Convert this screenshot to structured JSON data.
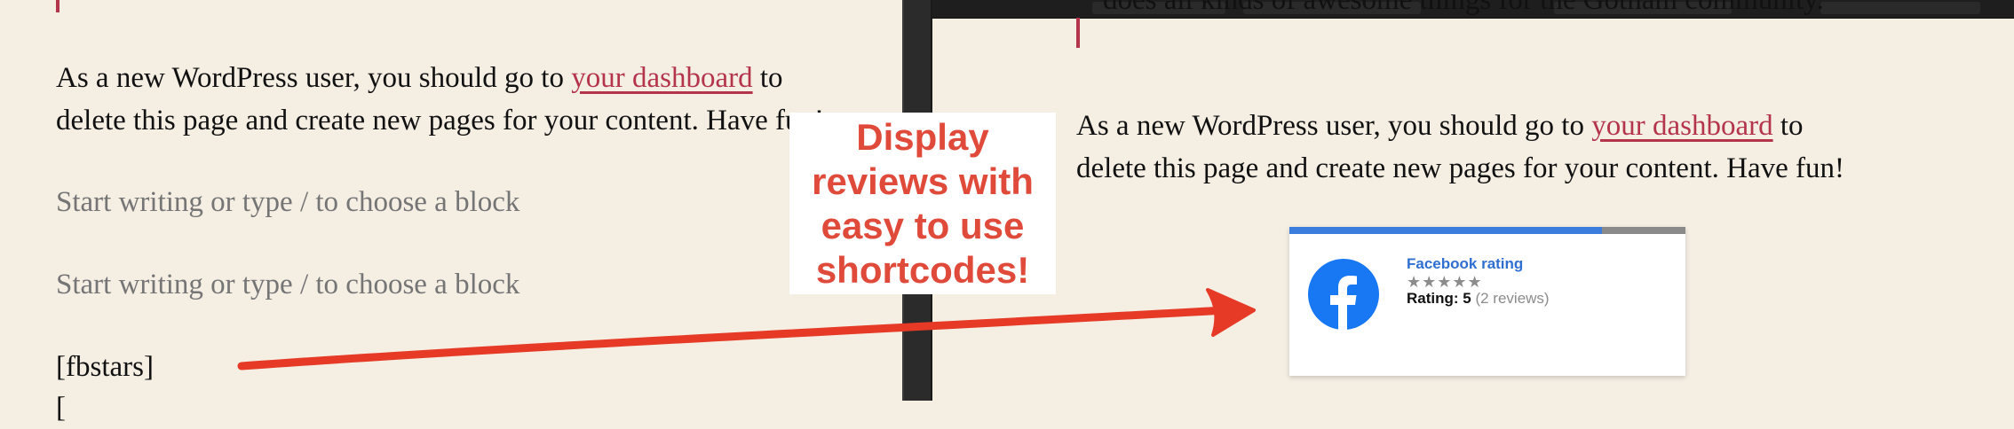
{
  "left_panel": {
    "intro_text_1": "As a new WordPress user, you should go to ",
    "intro_link": "your dashboard",
    "intro_text_2": " to",
    "intro_line_2": "delete this page and create new pages for your content. Have fun!",
    "placeholder_1": "Start writing or type / to choose a block",
    "placeholder_2": "Start writing or type / to choose a block",
    "shortcode_1": "[fbstars]"
  },
  "callout": {
    "lines": [
      "Display",
      "reviews with",
      "easy to use",
      "shortcodes!"
    ],
    "color": "#e04a3a"
  },
  "right_panel": {
    "quote_text": "does all kinds of awesome things for the Gotham community.",
    "intro_text_1": "As a new WordPress user, you should go to ",
    "intro_link": "your dashboard",
    "intro_text_2": " to",
    "intro_line_2": "delete this page and create new pages for your content. Have fun!"
  },
  "facebook_widget": {
    "title": "Facebook rating",
    "stars": "★★★★★",
    "star_count": 5,
    "rating_label": "Rating: 5",
    "reviews_text": "(2 reviews)",
    "progress": 0.79,
    "icon": "facebook-icon",
    "brand_color": "#1877f2"
  },
  "colors": {
    "link": "#b4344c",
    "page_bg": "#f4eee3",
    "arrow": "#e04a3a"
  }
}
